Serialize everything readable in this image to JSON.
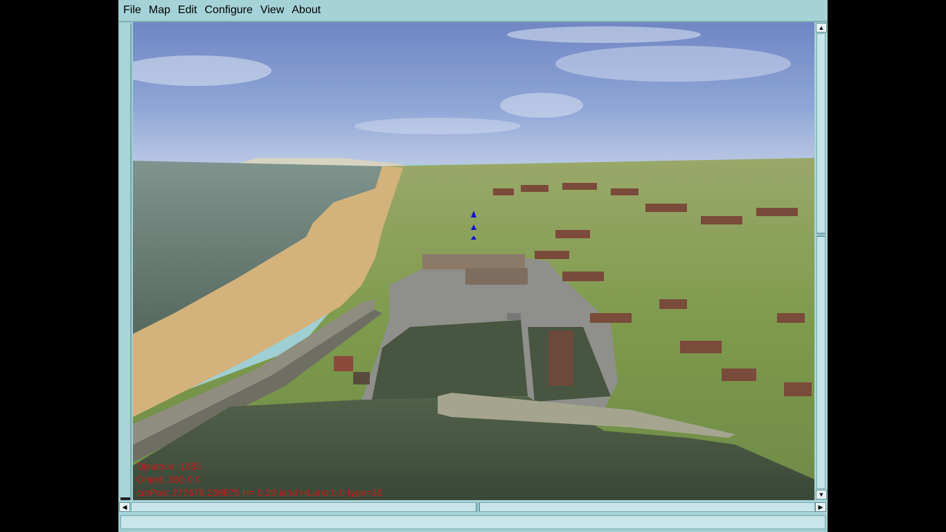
{
  "menu": {
    "file": "File",
    "map": "Map",
    "edit": "Edit",
    "configure": "Configure",
    "view": "View",
    "about": "About"
  },
  "overlay": {
    "distance": "Distance: 1035",
    "orient": "Orient: 360 0 0",
    "curpos": "curPos: 277676 238875 H= 0.20 land HLand:0.0 type=30"
  },
  "scroll": {
    "up_arrow": "▲",
    "down_arrow": "▼",
    "left_arrow": "◀",
    "right_arrow": "▶"
  },
  "colors": {
    "window_bg": "#a5d2d6",
    "overlay_text": "#cc1a1a"
  }
}
